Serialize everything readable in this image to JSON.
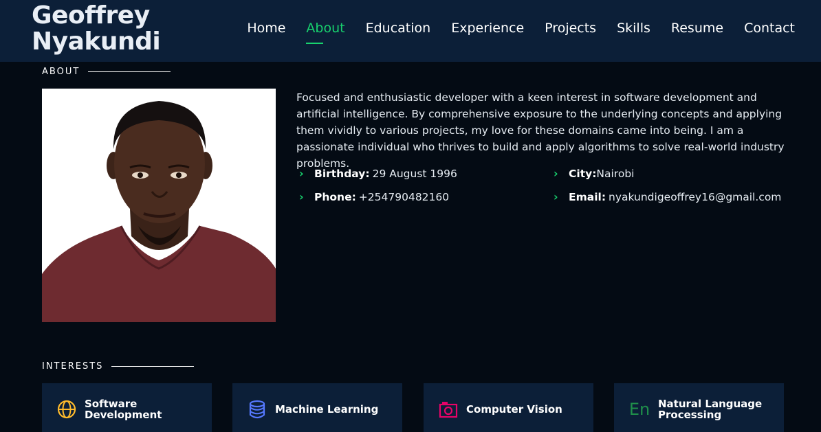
{
  "header": {
    "logo_line1": "Geoffrey",
    "logo_line2": "Nyakundi",
    "nav": [
      "Home",
      "About",
      "Education",
      "Experience",
      "Projects",
      "Skills",
      "Resume",
      "Contact"
    ],
    "active": "About"
  },
  "about": {
    "title": "ABOUT",
    "bio": "Focused and enthusiastic developer with a keen interest in software development and artificial intelligence. By comprehensive exposure to the underlying concepts and applying them vividly to various projects, my love for these domains came into being. I am a passionate individual who thrives to build and apply algorithms to solve real-world industry problems.",
    "birthday_label": "Birthday:",
    "birthday": "29 August 1996",
    "city_label": "City:",
    "city": "Nairobi",
    "phone_label": "Phone:",
    "phone": "+254790482160",
    "email_label": "Email:",
    "email": "nyakundigeoffrey16@gmail.com"
  },
  "interests": {
    "title": "INTERESTS",
    "items": [
      {
        "label": "Software Development",
        "icon": "globe-icon",
        "color": "#ffbb2c"
      },
      {
        "label": "Machine Learning",
        "icon": "database-icon",
        "color": "#5578ff"
      },
      {
        "label": "Computer Vision",
        "icon": "camera-icon",
        "color": "#e80368"
      },
      {
        "label": "Natural Language Processing",
        "icon": "language-icon",
        "color": "#11dbcf"
      }
    ],
    "nlp_icon_text": "En"
  },
  "colors": {
    "accent": "#18d26e",
    "header_bg": "#0c1f38",
    "page_bg": "#040b14"
  }
}
